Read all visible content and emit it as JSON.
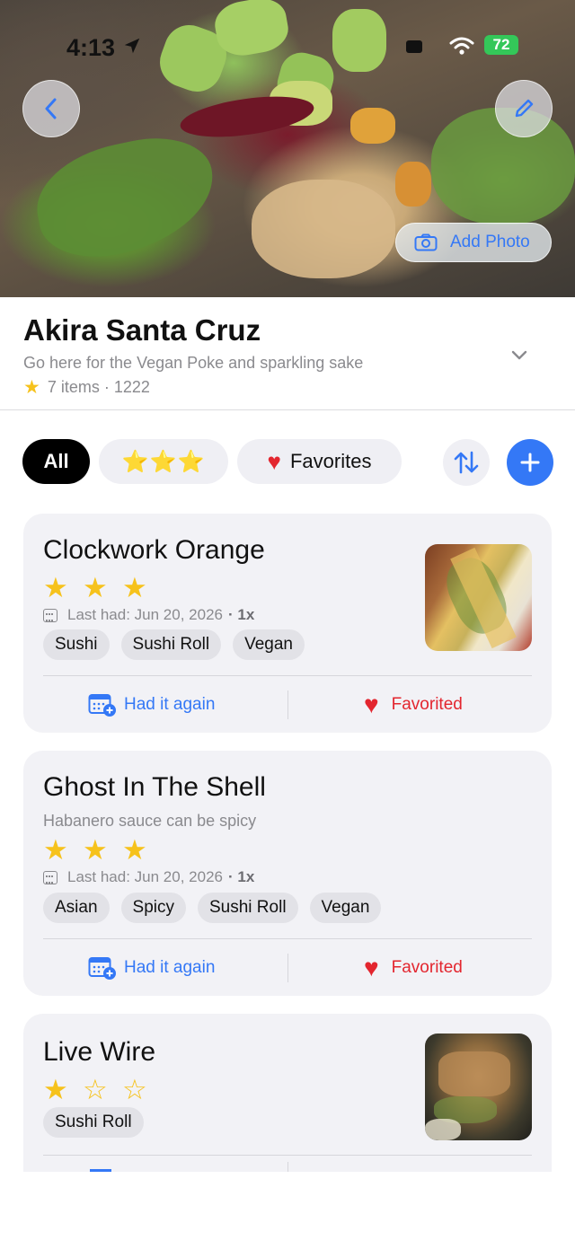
{
  "status_bar": {
    "time": "4:13",
    "battery": "72"
  },
  "hero": {
    "add_photo_label": "Add Photo"
  },
  "place": {
    "title": "Akira Santa Cruz",
    "subtitle": "Go here for the Vegan Poke and sparkling sake",
    "meta": "7 items · 1222"
  },
  "filters": {
    "all_label": "All",
    "stars_label": "⭐⭐⭐",
    "favorites_label": "Favorites"
  },
  "actions": {
    "had_again_label": "Had it again",
    "favorited_label": "Favorited"
  },
  "items": [
    {
      "name": "Clockwork Orange",
      "note": "",
      "rating": 3,
      "last_had": "Last had: Jun 20, 2026",
      "count": "· 1x",
      "tags": [
        "Sushi",
        "Sushi Roll",
        "Vegan"
      ],
      "favorited": true,
      "has_photo": true
    },
    {
      "name": "Ghost In The Shell",
      "note": "Habanero sauce can be spicy",
      "rating": 3,
      "last_had": "Last had: Jun 20, 2026",
      "count": "· 1x",
      "tags": [
        "Asian",
        "Spicy",
        "Sushi Roll",
        "Vegan"
      ],
      "favorited": true,
      "has_photo": false
    },
    {
      "name": "Live Wire",
      "note": "",
      "rating": 1,
      "last_had": "",
      "count": "",
      "tags": [
        "Sushi Roll"
      ],
      "favorited": false,
      "has_photo": true
    }
  ],
  "colors": {
    "accent": "#3478f6",
    "favorite": "#e3262f",
    "star": "#f6c21c"
  }
}
